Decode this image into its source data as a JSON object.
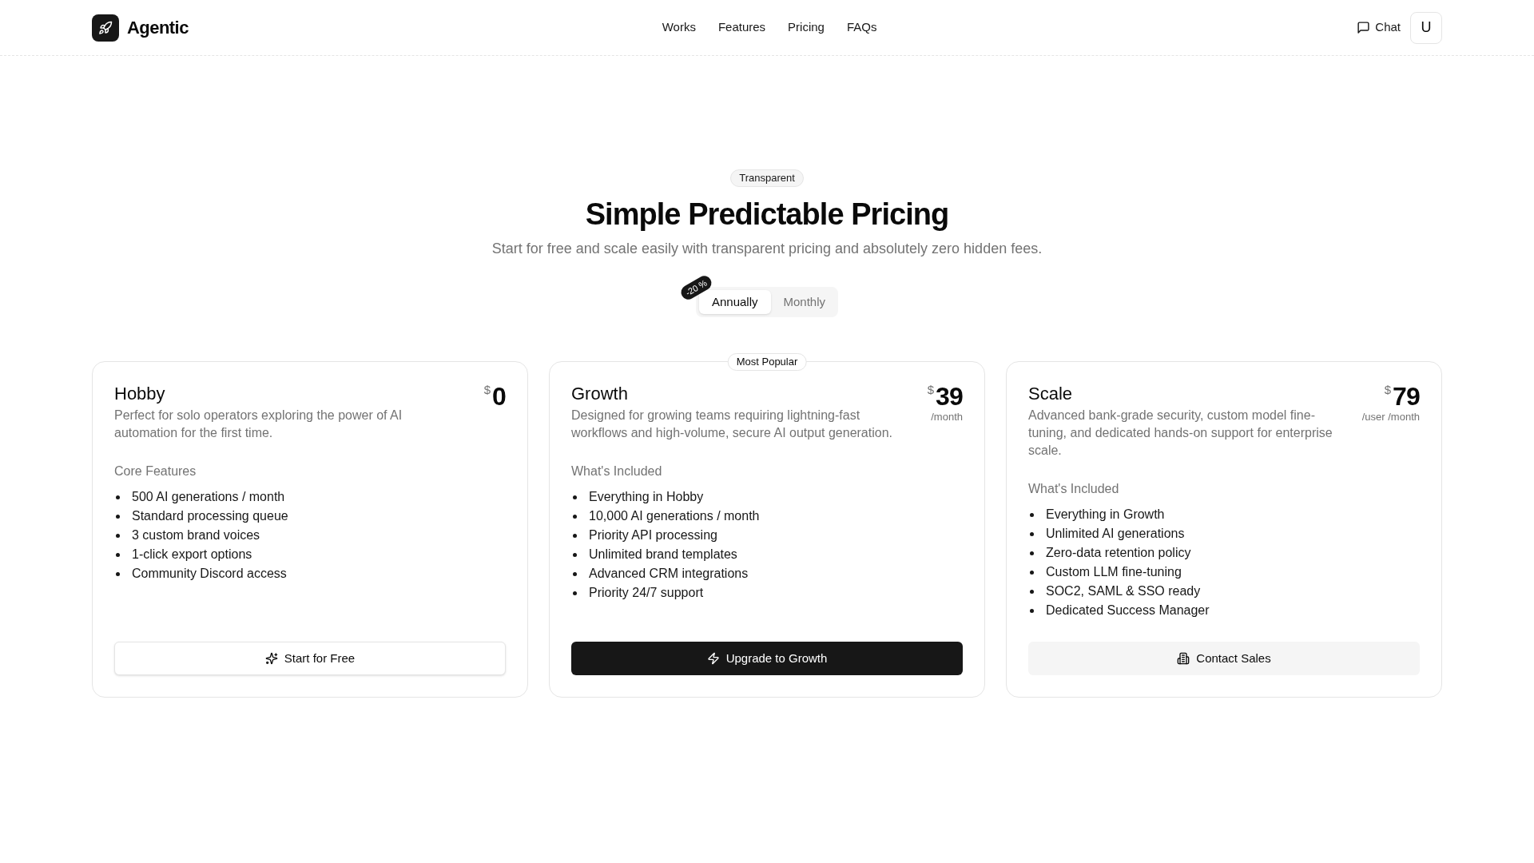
{
  "header": {
    "brand": "Agentic",
    "nav": [
      "Works",
      "Features",
      "Pricing",
      "FAQs"
    ],
    "chat_button": "Chat",
    "user_button": "U"
  },
  "hero": {
    "badge": "Transparent",
    "title": "Simple Predictable Pricing",
    "subtitle": "Start for free and scale easily with transparent pricing and absolutely zero hidden fees.",
    "billing_toggle": {
      "discount_badge": "-20 %",
      "options": [
        {
          "label": "Annually",
          "selected": true
        },
        {
          "label": "Monthly",
          "selected": false
        }
      ]
    }
  },
  "plans": [
    {
      "name": "Hobby",
      "description": "Perfect for solo operators exploring the power of AI automation for the first time.",
      "currency": "$",
      "price": "0",
      "features_heading": "Core Features",
      "features": [
        "500 AI generations / month",
        "Standard processing queue",
        "3 custom brand voices",
        "1-click export options",
        "Community Discord access"
      ],
      "button": {
        "label": "Start for Free",
        "kind": "outline"
      }
    },
    {
      "name": "Growth",
      "badge": "Most Popular",
      "description": "Designed for growing teams requiring lightning-fast workflows and high-volume, secure AI output generation.",
      "currency": "$",
      "price": "39",
      "period": "/month",
      "features_heading": "What's Included",
      "features": [
        "Everything in Hobby",
        "10,000 AI generations / month",
        "Priority API processing",
        "Unlimited brand templates",
        "Advanced CRM integrations",
        "Priority 24/7 support"
      ],
      "button": {
        "label": "Upgrade to Growth",
        "kind": "primary"
      }
    },
    {
      "name": "Scale",
      "description": "Advanced bank-grade security, custom model fine-tuning, and dedicated hands-on support for enterprise scale.",
      "currency": "$",
      "price": "79",
      "period": "/user /month",
      "features_heading": "What's Included",
      "features": [
        "Everything in Growth",
        "Unlimited AI generations",
        "Zero-data retention policy",
        "Custom LLM fine-tuning",
        "SOC2, SAML & SSO ready",
        "Dedicated Success Manager"
      ],
      "button": {
        "label": "Contact Sales",
        "kind": "secondary"
      }
    }
  ]
}
